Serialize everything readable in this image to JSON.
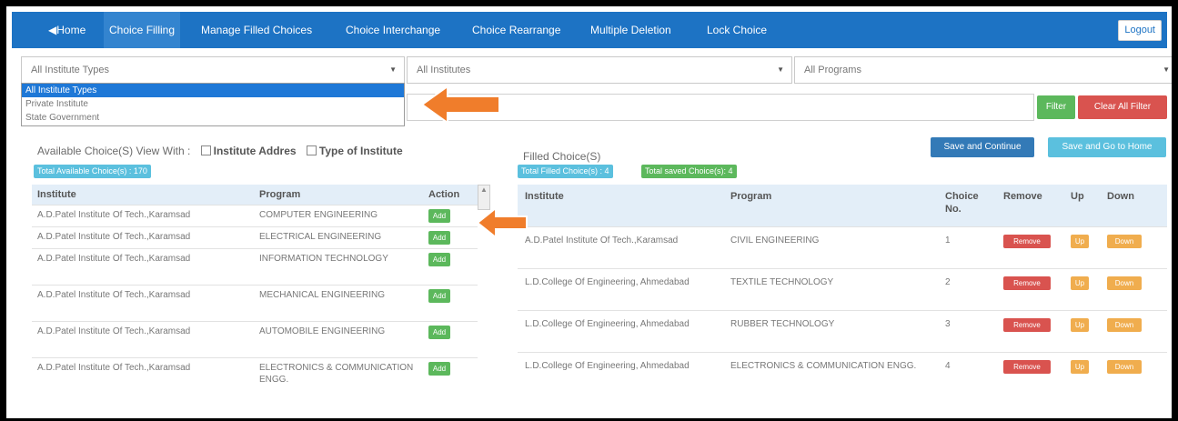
{
  "nav": {
    "items": [
      "◀Home",
      "Choice Filling",
      "Manage Filled Choices",
      "Choice Interchange",
      "Choice Rearrange",
      "Multiple Deletion",
      "Lock Choice"
    ],
    "logout": "Logout"
  },
  "filters": {
    "institute_type": {
      "value": "All Institute Types",
      "options": [
        "All Institute Types",
        "Private Institute",
        "State Government"
      ]
    },
    "institute": {
      "value": "All Institutes"
    },
    "program": {
      "value": "All Programs"
    },
    "filter_label": "Filter",
    "clear_label": "Clear All Filter"
  },
  "available": {
    "title": "Available Choice(S) View With :",
    "opt_address": "Institute Addres",
    "opt_type": "Type of Institute",
    "badge": "Total Available Choice(s) : 170",
    "columns": [
      "Institute",
      "Program",
      "Action"
    ],
    "add_label": "Add",
    "rows": [
      {
        "institute": "A.D.Patel Institute Of Tech.,Karamsad",
        "program": "COMPUTER ENGINEERING"
      },
      {
        "institute": "A.D.Patel Institute Of Tech.,Karamsad",
        "program": "ELECTRICAL ENGINEERING"
      },
      {
        "institute": "A.D.Patel Institute Of Tech.,Karamsad",
        "program": "INFORMATION TECHNOLOGY"
      },
      {
        "institute": "A.D.Patel Institute Of Tech.,Karamsad",
        "program": "MECHANICAL ENGINEERING"
      },
      {
        "institute": "A.D.Patel Institute Of Tech.,Karamsad",
        "program": "AUTOMOBILE ENGINEERING"
      },
      {
        "institute": "A.D.Patel Institute Of Tech.,Karamsad",
        "program": "ELECTRONICS & COMMUNICATION ENGG."
      }
    ]
  },
  "filled": {
    "title": "Filled Choice(S)",
    "badge_filled": "Total Filled Choice(s) : 4",
    "badge_saved": "Total saved Choice(s): 4",
    "save_continue": "Save and Continue",
    "save_proceed": "Save and Go to Home",
    "columns": [
      "Institute",
      "Program",
      "Choice No.",
      "Remove",
      "Up",
      "Down"
    ],
    "remove_label": "Remove",
    "up_label": "Up",
    "down_label": "Down",
    "rows": [
      {
        "institute": "A.D.Patel Institute Of Tech.,Karamsad",
        "program": "CIVIL ENGINEERING",
        "no": "1"
      },
      {
        "institute": "L.D.College Of Engineering, Ahmedabad",
        "program": "TEXTILE TECHNOLOGY",
        "no": "2"
      },
      {
        "institute": "L.D.College Of Engineering, Ahmedabad",
        "program": "RUBBER TECHNOLOGY",
        "no": "3"
      },
      {
        "institute": "L.D.College Of Engineering, Ahmedabad",
        "program": "ELECTRONICS & COMMUNICATION ENGG.",
        "no": "4"
      }
    ]
  },
  "colors": {
    "nav": "#1d73c4",
    "arrow": "#f07d2b",
    "add": "#5cb85c",
    "remove": "#d9534f",
    "updown": "#f0ad4e"
  }
}
